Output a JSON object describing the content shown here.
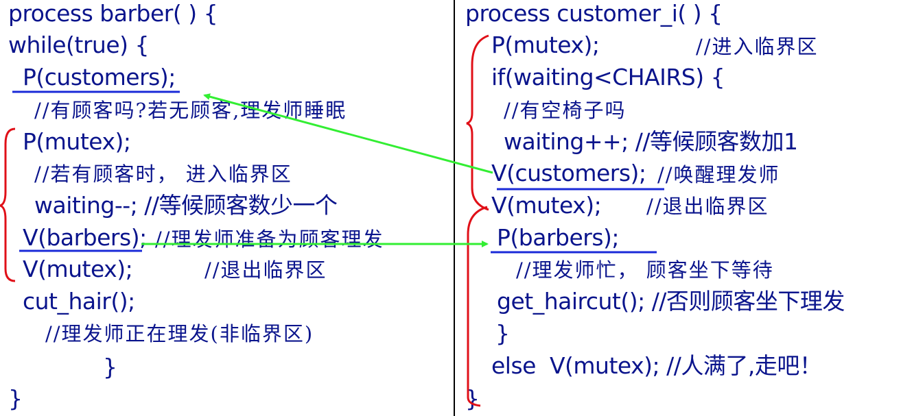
{
  "barber": {
    "header": "process barber( ) {",
    "loop": "while(true) {",
    "p_customers": "P(customers);",
    "comment_has_customer": "//有顾客吗?若无顾客,理发师睡眠",
    "p_mutex": "P(mutex);",
    "comment_enter": "//若有顾客时， 进入临界区",
    "waiting_dec": "waiting--; //等候顾客数少一个",
    "v_barbers": "V(barbers);",
    "v_barbers_comment": "//理发师准备为顾客理发",
    "v_mutex": "V(mutex);",
    "v_mutex_comment": "//退出临界区",
    "cut_hair": "cut_hair();",
    "cut_comment": "//理发师正在理发(非临界区)",
    "inner_close": "}",
    "outer_close": "}"
  },
  "customer": {
    "header": "process customer_i( ) {",
    "p_mutex": "P(mutex);",
    "p_mutex_comment": "//进入临界区",
    "if_waiting": "if(waiting<CHAIRS) {",
    "comment_chair": "//有空椅子吗",
    "waiting_inc": "waiting++; //等候顾客数加1",
    "v_customers": "V(customers);",
    "v_customers_comment": "//唤醒理发师",
    "v_mutex": "V(mutex);",
    "v_mutex_comment": "//退出临界区",
    "p_barbers": "P(barbers);",
    "comment_busy": "//理发师忙， 顾客坐下等待",
    "get_haircut": "get_haircut(); //否则顾客坐下理发",
    "if_close": "}",
    "else_line": "else  V(mutex); //人满了,走吧！",
    "outer_close": "}"
  },
  "colors": {
    "text": "#0a148c",
    "bracket": "#e01018",
    "arrow": "#33ee33",
    "underline": "#1a2ad8",
    "divider": "#000000"
  }
}
